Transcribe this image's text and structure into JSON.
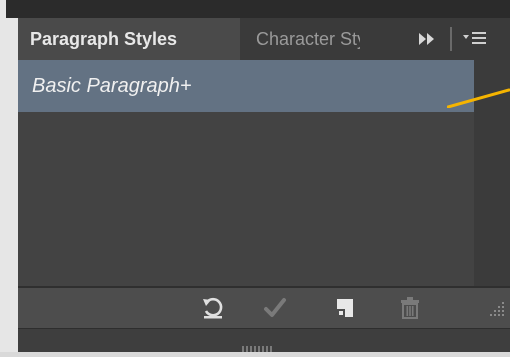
{
  "tabs": [
    {
      "label": "Paragraph Styles",
      "active": true
    },
    {
      "label": "Character Styles",
      "active": false
    }
  ],
  "tab_controls": {
    "expand_icon": "double-chevron-right-icon",
    "menu_icon": "panel-menu-icon"
  },
  "styles_list": [
    {
      "label": "Basic Paragraph+",
      "selected": true
    }
  ],
  "footer_buttons": [
    {
      "name": "clear-overrides",
      "icon": "clear-overrides-icon",
      "enabled": true
    },
    {
      "name": "redefine-style",
      "icon": "checkmark-icon",
      "enabled": false
    },
    {
      "name": "new-style",
      "icon": "new-style-icon",
      "enabled": true
    },
    {
      "name": "delete-style",
      "icon": "trash-icon",
      "enabled": false
    }
  ],
  "colors": {
    "panel_bg": "#434343",
    "selection": "#637283",
    "callout": "#f5b400",
    "active_tab": "#4a4a4a"
  }
}
